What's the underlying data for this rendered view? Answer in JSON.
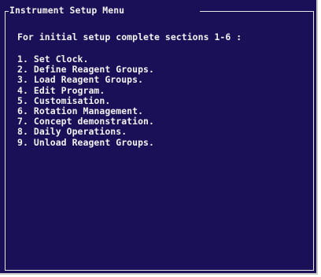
{
  "window": {
    "title": "Instrument Setup Menu"
  },
  "instruction": "For initial setup complete sections 1-6 :",
  "menu": {
    "items": [
      {
        "number": "1.",
        "label": "Set Clock."
      },
      {
        "number": "2.",
        "label": "Define Reagent Groups."
      },
      {
        "number": "3.",
        "label": "Load Reagent Groups."
      },
      {
        "number": "4.",
        "label": "Edit Program."
      },
      {
        "number": "5.",
        "label": "Customisation."
      },
      {
        "number": "6.",
        "label": "Rotation Management."
      },
      {
        "number": "7.",
        "label": "Concept demonstration."
      },
      {
        "number": "8.",
        "label": "Daily Operations."
      },
      {
        "number": "9.",
        "label": "Unload Reagent Groups."
      }
    ]
  },
  "colors": {
    "background": "#1a1058",
    "text": "#f2f2f2",
    "border": "#e8e8e8"
  }
}
